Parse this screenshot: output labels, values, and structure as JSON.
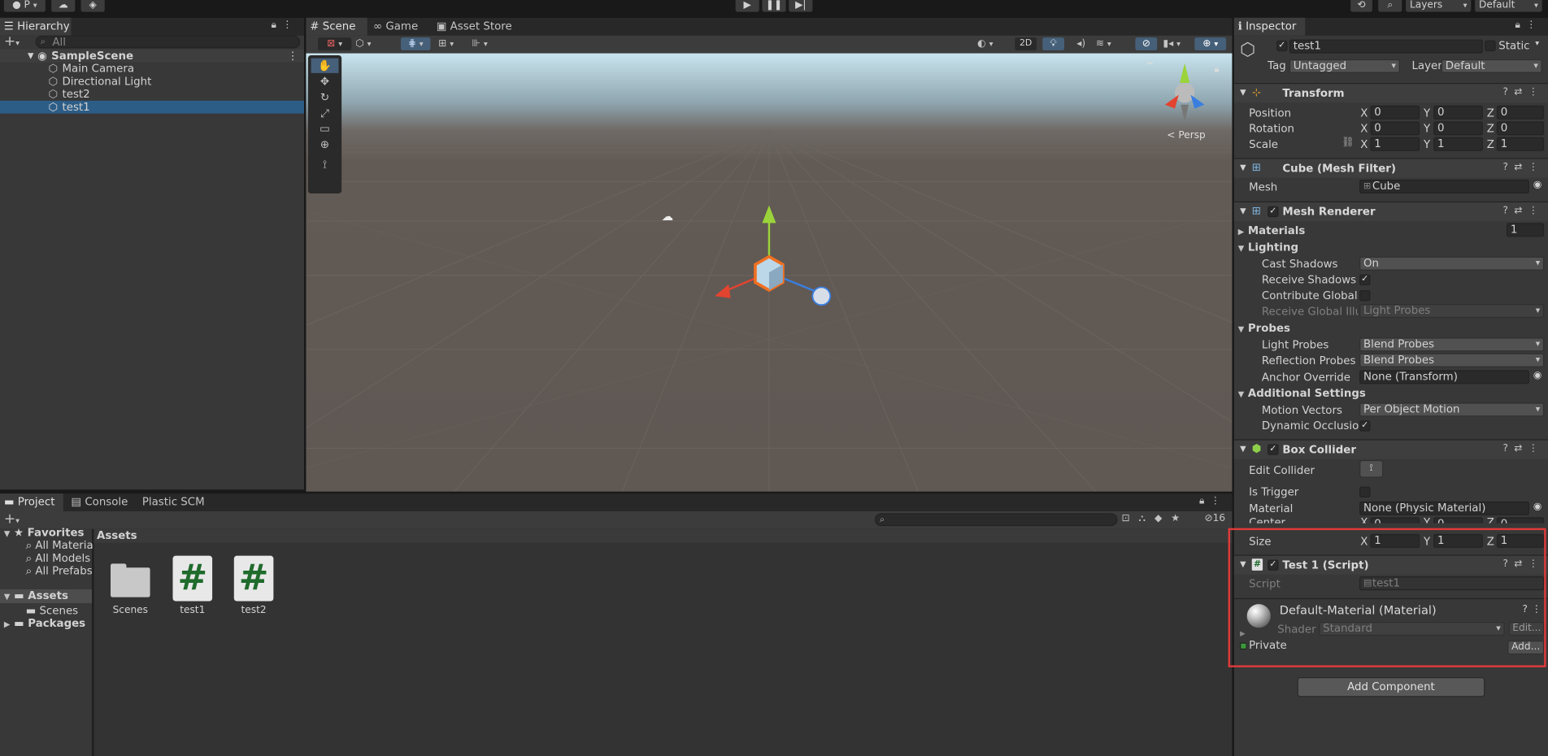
{
  "toolbar": {
    "account_label": "P",
    "layers_label": "Layers",
    "layout_label": "Default"
  },
  "hierarchy": {
    "tab_label": "Hierarchy",
    "search_placeholder": "All",
    "scene_name": "SampleScene",
    "items": [
      {
        "label": "Main Camera"
      },
      {
        "label": "Directional Light"
      },
      {
        "label": "test2"
      },
      {
        "label": "test1"
      }
    ]
  },
  "scene_view": {
    "tabs": [
      {
        "label": "Scene"
      },
      {
        "label": "Game"
      },
      {
        "label": "Asset Store"
      }
    ],
    "mode_2d": "2D",
    "persp_label": "< Persp"
  },
  "inspector": {
    "tab_label": "Inspector",
    "object_name": "test1",
    "static_label": "Static",
    "tag_label": "Tag",
    "tag_value": "Untagged",
    "layer_label": "Layer",
    "layer_value": "Default",
    "transform": {
      "title": "Transform",
      "position_label": "Position",
      "rotation_label": "Rotation",
      "scale_label": "Scale",
      "position": {
        "x": "0",
        "y": "0",
        "z": "0"
      },
      "rotation": {
        "x": "0",
        "y": "0",
        "z": "0"
      },
      "scale": {
        "x": "1",
        "y": "1",
        "z": "1"
      }
    },
    "mesh_filter": {
      "title": "Cube (Mesh Filter)",
      "mesh_label": "Mesh",
      "mesh_value": "Cube"
    },
    "mesh_renderer": {
      "title": "Mesh Renderer",
      "materials_label": "Materials",
      "materials_count": "1",
      "lighting_label": "Lighting",
      "cast_shadows_label": "Cast Shadows",
      "cast_shadows_value": "On",
      "receive_shadows_label": "Receive Shadows",
      "contribute_gi_label": "Contribute Global Illu",
      "receive_gi_label": "Receive Global Illumi",
      "receive_gi_value": "Light Probes",
      "probes_label": "Probes",
      "light_probes_label": "Light Probes",
      "light_probes_value": "Blend Probes",
      "reflection_probes_label": "Reflection Probes",
      "reflection_probes_value": "Blend Probes",
      "anchor_override_label": "Anchor Override",
      "anchor_override_value": "None (Transform)",
      "additional_label": "Additional Settings",
      "motion_vectors_label": "Motion Vectors",
      "motion_vectors_value": "Per Object Motion",
      "dynamic_occlusion_label": "Dynamic Occlusion"
    },
    "box_collider": {
      "title": "Box Collider",
      "edit_collider_label": "Edit Collider",
      "is_trigger_label": "Is Trigger",
      "material_label": "Material",
      "material_value": "None (Physic Material)",
      "center_label": "Center",
      "center": {
        "x": "0",
        "y": "0",
        "z": "0"
      },
      "size_label": "Size",
      "size": {
        "x": "1",
        "y": "1",
        "z": "1"
      }
    },
    "script_component": {
      "title": "Test 1 (Script)",
      "script_label": "Script",
      "script_value": "test1"
    },
    "material": {
      "title": "Default-Material (Material)",
      "shader_label": "Shader",
      "shader_value": "Standard",
      "edit_label": "Edit...",
      "private_label": "Private",
      "add_label": "Add..."
    },
    "add_component_label": "Add Component",
    "axis_x": "X",
    "axis_y": "Y",
    "axis_z": "Z"
  },
  "project": {
    "tabs": [
      {
        "label": "Project"
      },
      {
        "label": "Console"
      },
      {
        "label": "Plastic SCM"
      }
    ],
    "hidden_count": "16",
    "favorites_label": "Favorites",
    "favorites": [
      {
        "label": "All Materials"
      },
      {
        "label": "All Models"
      },
      {
        "label": "All Prefabs"
      }
    ],
    "assets_label": "Assets",
    "scenes_label": "Scenes",
    "packages_label": "Packages",
    "breadcrumb": "Assets",
    "assets": [
      {
        "label": "Scenes",
        "kind": "folder"
      },
      {
        "label": "test1",
        "kind": "script"
      },
      {
        "label": "test2",
        "kind": "script"
      }
    ]
  },
  "colors": {
    "selection": "#2c5d87",
    "highlight_box": "#e03a3a",
    "script_hash": "#1f6b2c"
  }
}
